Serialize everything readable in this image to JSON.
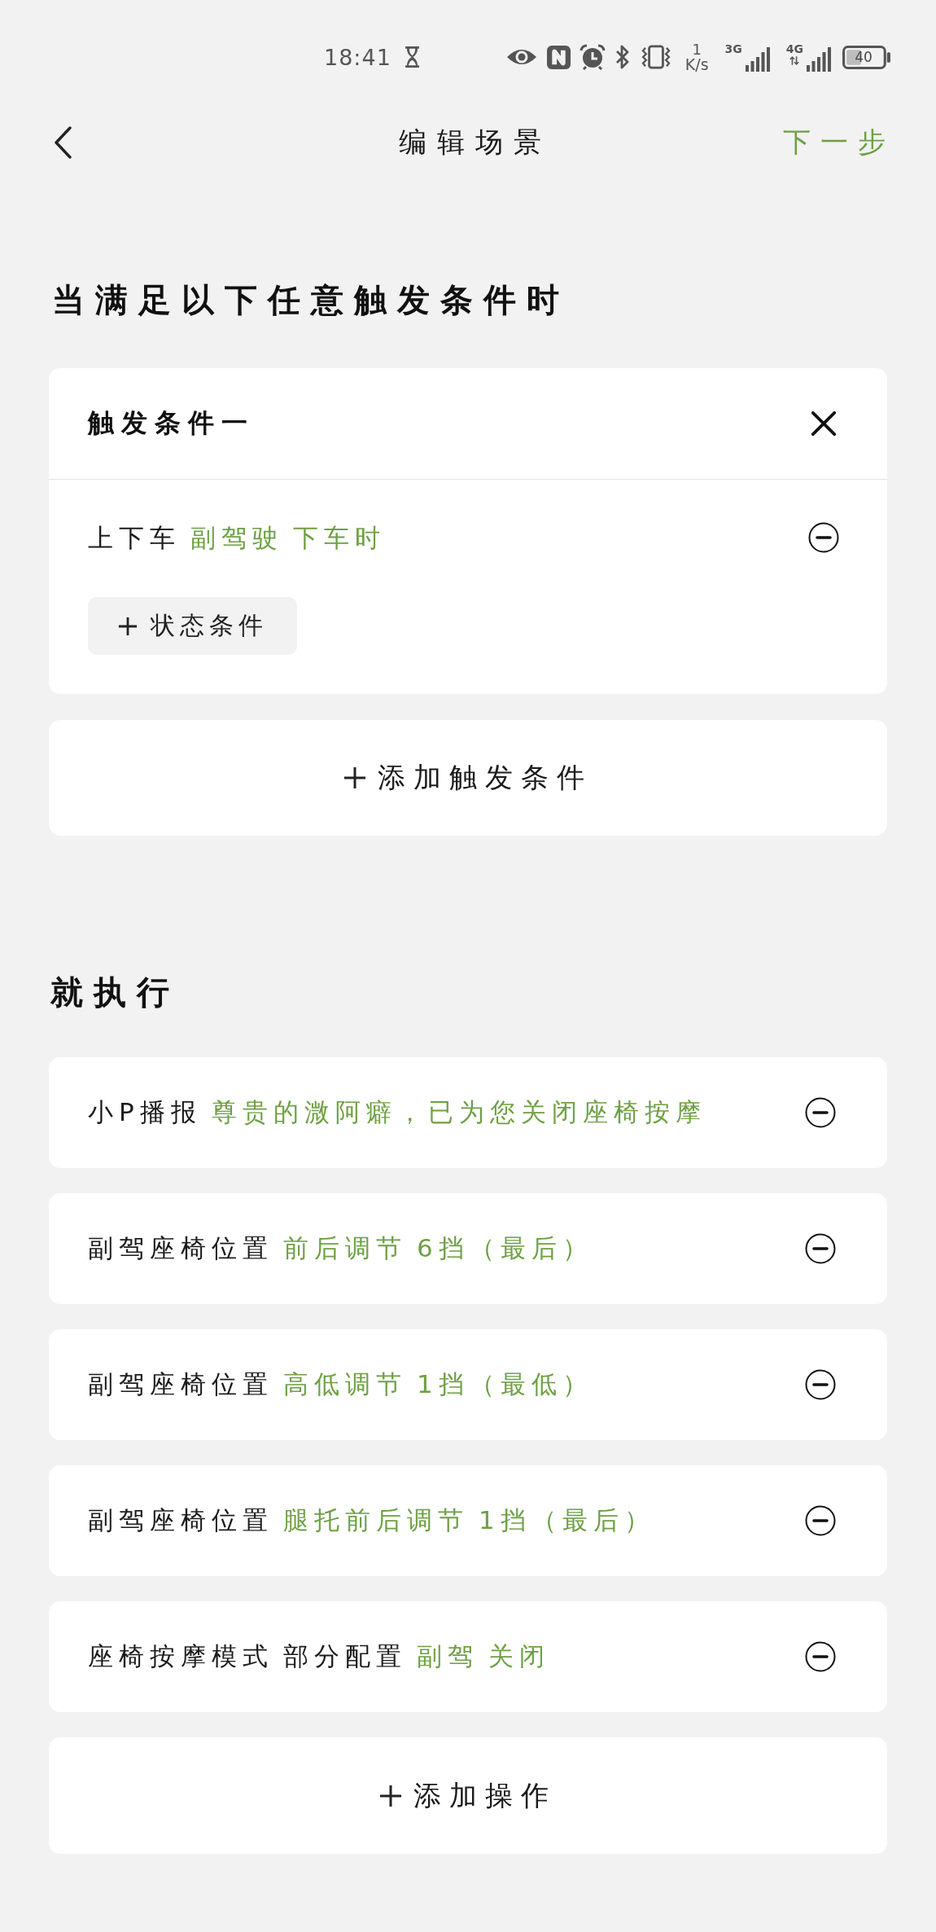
{
  "status_bar": {
    "time": "18:41",
    "speed_value": "1",
    "speed_unit": "K/s",
    "sim_1_network": "3G",
    "sim_2_network": "4G",
    "battery": "40"
  },
  "header": {
    "title": "编辑场景",
    "next_button": "下一步"
  },
  "trigger_section": {
    "heading": "当满足以下任意触发条件时",
    "groups": [
      {
        "title": "触发条件一",
        "conditions": [
          {
            "labels": [
              "上下车"
            ],
            "values": [
              "副驾驶",
              "下车时"
            ]
          }
        ],
        "add_condition_button": "状态条件"
      }
    ],
    "add_trigger_button": "添加触发条件"
  },
  "action_section": {
    "heading": "就执行",
    "actions": [
      {
        "labels": [
          "小P播报"
        ],
        "values": [
          "尊贵的溦阿癖，已为您关闭座椅按摩"
        ]
      },
      {
        "labels": [
          "副驾座椅位置"
        ],
        "values": [
          "前后调节",
          "6挡（最后）"
        ]
      },
      {
        "labels": [
          "副驾座椅位置"
        ],
        "values": [
          "高低调节",
          "1挡（最低）"
        ]
      },
      {
        "labels": [
          "副驾座椅位置"
        ],
        "values": [
          "腿托前后调节",
          "1挡（最后）"
        ]
      },
      {
        "labels": [
          "座椅按摩模式",
          "部分配置"
        ],
        "values": [
          "副驾",
          "关闭"
        ]
      }
    ],
    "add_action_button": "添加操作"
  }
}
